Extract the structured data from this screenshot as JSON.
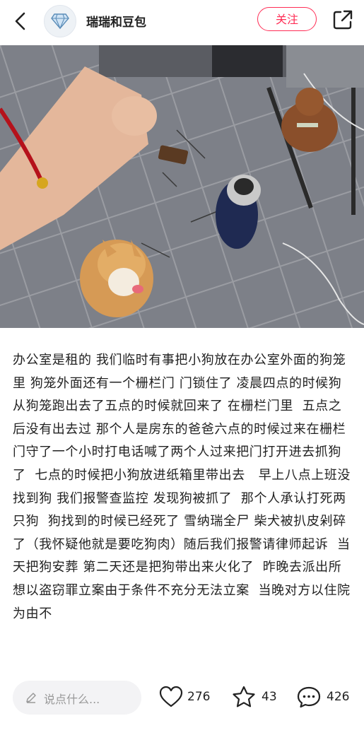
{
  "header": {
    "author_name": "瑞瑞和豆包",
    "follow_label": "关注"
  },
  "post": {
    "body": "办公室是租的 我们临时有事把小狗放在办公室外面的狗笼里 狗笼外面还有一个栅栏门 门锁住了 凌晨四点的时候狗从狗笼跑出去了五点的时候就回来了 在栅栏门里  五点之后没有出去过 那个人是房东的爸爸六点的时候过来在栅栏门守了一个小时打电话喊了两个人过来把门打开进去抓狗了  七点的时候把小狗放进纸箱里带出去   早上八点上班没找到狗 我们报警查监控 发现狗被抓了  那个人承认打死两只狗  狗找到的时候已经死了 雪纳瑞全尸 柴犬被扒皮剁碎了（我怀疑他就是要吃狗肉）随后我们报警请律师起诉  当天把狗安葬 第二天还是把狗带出来火化了  昨晚去派出所想以盗窃罪立案由于条件不充分无法立案  当晚对方以住院为由不"
  },
  "bottom": {
    "comment_placeholder": "说点什么...",
    "likes": "276",
    "collects": "43",
    "comments": "426"
  },
  "colors": {
    "accent": "#ff2d55"
  },
  "icons": [
    "back-arrow-icon",
    "diamond-icon",
    "share-icon",
    "pencil-icon",
    "heart-icon",
    "star-icon",
    "comment-bubble-icon"
  ]
}
